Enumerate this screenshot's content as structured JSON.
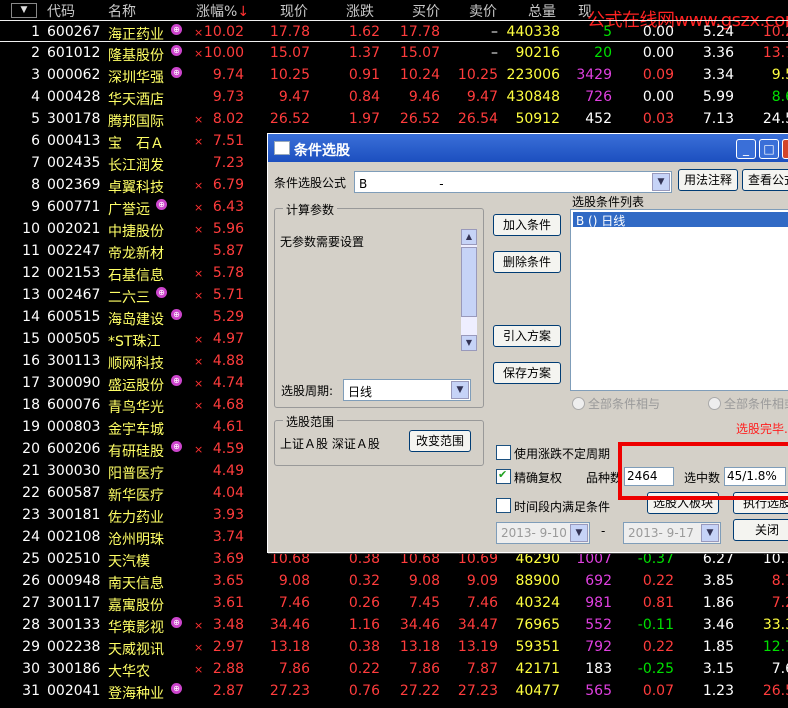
{
  "header": {
    "sort_btn": "▼",
    "cols": [
      "代码",
      "名称",
      "涨幅%",
      "现价",
      "涨跌",
      "买价",
      "卖价",
      "总量",
      "现"
    ],
    "sort_arrow": "↓"
  },
  "watermark": "公式在线网www.gszx.com.cn",
  "rows": [
    {
      "n": "1",
      "code": "600267",
      "name": "海正药业",
      "b": true,
      "x": "×",
      "chg": "10.02",
      "price": "17.78",
      "d": "1.62",
      "buy": "17.78",
      "sell": "–",
      "vol": "440338",
      "cur": "5",
      "su": "0.00",
      "tr": "5.24",
      "pe": "10.2"
    },
    {
      "n": "2",
      "code": "601012",
      "name": "隆基股份",
      "b": true,
      "x": "×",
      "chg": "10.00",
      "price": "15.07",
      "d": "1.37",
      "buy": "15.07",
      "sell": "–",
      "vol": "90216",
      "cur": "20",
      "su": "0.00",
      "tr": "3.36",
      "pe": "13.7"
    },
    {
      "n": "3",
      "code": "000062",
      "name": "深圳华强",
      "b": true,
      "x": "",
      "chg": "9.74",
      "price": "10.25",
      "d": "0.91",
      "buy": "10.24",
      "sell": "10.25",
      "vol": "223006",
      "cur": "3429",
      "su": "0.09",
      "tr": "3.34",
      "pe": "9.5"
    },
    {
      "n": "4",
      "code": "000428",
      "name": "华天酒店",
      "b": false,
      "x": "",
      "chg": "9.73",
      "price": "9.47",
      "d": "0.84",
      "buy": "9.46",
      "sell": "9.47",
      "vol": "430848",
      "cur": "726",
      "su": "0.00",
      "tr": "5.99",
      "pe": "8.6"
    },
    {
      "n": "5",
      "code": "300178",
      "name": "腾邦国际",
      "b": false,
      "x": "×",
      "chg": "8.02",
      "price": "26.52",
      "d": "1.97",
      "buy": "26.52",
      "sell": "26.54",
      "vol": "50912",
      "cur": "452",
      "su": "0.03",
      "tr": "7.13",
      "pe": "24.5"
    },
    {
      "n": "6",
      "code": "000413",
      "name": "宝　石Ａ",
      "b": false,
      "x": "×",
      "chg": "7.51",
      "price": "",
      "d": "",
      "buy": "",
      "sell": "",
      "vol": "",
      "cur": "",
      "su": "",
      "tr": "",
      "pe": ""
    },
    {
      "n": "7",
      "code": "002435",
      "name": "长江润发",
      "b": false,
      "x": "",
      "chg": "7.23",
      "price": "",
      "d": "",
      "buy": "",
      "sell": "",
      "vol": "",
      "cur": "",
      "su": "",
      "tr": "",
      "pe": ""
    },
    {
      "n": "8",
      "code": "002369",
      "name": "卓翼科技",
      "b": false,
      "x": "×",
      "chg": "6.79",
      "price": "",
      "d": "",
      "buy": "",
      "sell": "",
      "vol": "",
      "cur": "",
      "su": "",
      "tr": "",
      "pe": ""
    },
    {
      "n": "9",
      "code": "600771",
      "name": "广誉远",
      "b": true,
      "x": "×",
      "chg": "6.43",
      "price": "",
      "d": "",
      "buy": "",
      "sell": "",
      "vol": "",
      "cur": "",
      "su": "",
      "tr": "",
      "pe": ""
    },
    {
      "n": "10",
      "code": "002021",
      "name": "中捷股份",
      "b": false,
      "x": "×",
      "chg": "5.96",
      "price": "",
      "d": "",
      "buy": "",
      "sell": "",
      "vol": "",
      "cur": "",
      "su": "",
      "tr": "",
      "pe": ""
    },
    {
      "n": "11",
      "code": "002247",
      "name": "帝龙新材",
      "b": false,
      "x": "",
      "chg": "5.87",
      "price": "",
      "d": "",
      "buy": "",
      "sell": "",
      "vol": "",
      "cur": "",
      "su": "",
      "tr": "",
      "pe": ""
    },
    {
      "n": "12",
      "code": "002153",
      "name": "石基信息",
      "b": false,
      "x": "×",
      "chg": "5.78",
      "price": "",
      "d": "",
      "buy": "",
      "sell": "",
      "vol": "",
      "cur": "",
      "su": "",
      "tr": "",
      "pe": ""
    },
    {
      "n": "13",
      "code": "002467",
      "name": "二六三",
      "b": true,
      "x": "×",
      "chg": "5.71",
      "price": "",
      "d": "",
      "buy": "",
      "sell": "",
      "vol": "",
      "cur": "",
      "su": "",
      "tr": "",
      "pe": ""
    },
    {
      "n": "14",
      "code": "600515",
      "name": "海岛建设",
      "b": true,
      "x": "",
      "chg": "5.29",
      "price": "",
      "d": "",
      "buy": "",
      "sell": "",
      "vol": "",
      "cur": "",
      "su": "",
      "tr": "",
      "pe": ""
    },
    {
      "n": "15",
      "code": "000505",
      "name": "*ST珠江",
      "b": false,
      "x": "×",
      "chg": "4.97",
      "price": "",
      "d": "",
      "buy": "",
      "sell": "",
      "vol": "",
      "cur": "",
      "su": "",
      "tr": "",
      "pe": ""
    },
    {
      "n": "16",
      "code": "300113",
      "name": "顺网科技",
      "b": false,
      "x": "×",
      "chg": "4.88",
      "price": "",
      "d": "",
      "buy": "",
      "sell": "",
      "vol": "",
      "cur": "",
      "su": "",
      "tr": "",
      "pe": ""
    },
    {
      "n": "17",
      "code": "300090",
      "name": "盛运股份",
      "b": true,
      "x": "×",
      "chg": "4.74",
      "price": "",
      "d": "",
      "buy": "",
      "sell": "",
      "vol": "",
      "cur": "",
      "su": "",
      "tr": "",
      "pe": ""
    },
    {
      "n": "18",
      "code": "600076",
      "name": "青鸟华光",
      "b": false,
      "x": "×",
      "chg": "4.68",
      "price": "",
      "d": "",
      "buy": "",
      "sell": "",
      "vol": "",
      "cur": "",
      "su": "",
      "tr": "",
      "pe": ""
    },
    {
      "n": "19",
      "code": "000803",
      "name": "金宇车城",
      "b": false,
      "x": "",
      "chg": "4.61",
      "price": "",
      "d": "",
      "buy": "",
      "sell": "",
      "vol": "",
      "cur": "",
      "su": "",
      "tr": "",
      "pe": ""
    },
    {
      "n": "20",
      "code": "600206",
      "name": "有研硅股",
      "b": true,
      "x": "×",
      "chg": "4.59",
      "price": "",
      "d": "",
      "buy": "",
      "sell": "",
      "vol": "",
      "cur": "",
      "su": "",
      "tr": "",
      "pe": ""
    },
    {
      "n": "21",
      "code": "300030",
      "name": "阳普医疗",
      "b": false,
      "x": "",
      "chg": "4.49",
      "price": "",
      "d": "",
      "buy": "",
      "sell": "",
      "vol": "",
      "cur": "",
      "su": "",
      "tr": "",
      "pe": ""
    },
    {
      "n": "22",
      "code": "600587",
      "name": "新华医疗",
      "b": false,
      "x": "",
      "chg": "4.04",
      "price": "",
      "d": "",
      "buy": "",
      "sell": "",
      "vol": "",
      "cur": "",
      "su": "",
      "tr": "",
      "pe": ""
    },
    {
      "n": "23",
      "code": "300181",
      "name": "佐力药业",
      "b": false,
      "x": "",
      "chg": "3.93",
      "price": "",
      "d": "",
      "buy": "",
      "sell": "",
      "vol": "",
      "cur": "",
      "su": "",
      "tr": "",
      "pe": ""
    },
    {
      "n": "24",
      "code": "002108",
      "name": "沧州明珠",
      "b": false,
      "x": "",
      "chg": "3.74",
      "price": "",
      "d": "",
      "buy": "",
      "sell": "",
      "vol": "",
      "cur": "",
      "su": "",
      "tr": "",
      "pe": ""
    },
    {
      "n": "25",
      "code": "002510",
      "name": "天汽模",
      "b": false,
      "x": "",
      "chg": "3.69",
      "price": "10.68",
      "d": "0.38",
      "buy": "10.68",
      "sell": "10.69",
      "vol": "46290",
      "cur": "1007",
      "su": "-0.37",
      "tr": "6.27",
      "pe": "10.7"
    },
    {
      "n": "26",
      "code": "000948",
      "name": "南天信息",
      "b": false,
      "x": "",
      "chg": "3.65",
      "price": "9.08",
      "d": "0.32",
      "buy": "9.08",
      "sell": "9.09",
      "vol": "88900",
      "cur": "692",
      "su": "0.22",
      "tr": "3.85",
      "pe": "8.7"
    },
    {
      "n": "27",
      "code": "300117",
      "name": "嘉寓股份",
      "b": false,
      "x": "",
      "chg": "3.61",
      "price": "7.46",
      "d": "0.26",
      "buy": "7.45",
      "sell": "7.46",
      "vol": "40324",
      "cur": "981",
      "su": "0.81",
      "tr": "1.86",
      "pe": "7.2"
    },
    {
      "n": "28",
      "code": "300133",
      "name": "华策影视",
      "b": true,
      "x": "×",
      "chg": "3.48",
      "price": "34.46",
      "d": "1.16",
      "buy": "34.46",
      "sell": "34.47",
      "vol": "76965",
      "cur": "552",
      "su": "-0.11",
      "tr": "3.46",
      "pe": "33.3"
    },
    {
      "n": "29",
      "code": "002238",
      "name": "天威视讯",
      "b": false,
      "x": "×",
      "chg": "2.97",
      "price": "13.18",
      "d": "0.38",
      "buy": "13.18",
      "sell": "13.19",
      "vol": "59351",
      "cur": "792",
      "su": "0.22",
      "tr": "1.85",
      "pe": "12.7"
    },
    {
      "n": "30",
      "code": "300186",
      "name": "大华农",
      "b": false,
      "x": "×",
      "chg": "2.88",
      "price": "7.86",
      "d": "0.22",
      "buy": "7.86",
      "sell": "7.87",
      "vol": "42171",
      "cur": "183",
      "su": "-0.25",
      "tr": "3.15",
      "pe": "7.6"
    },
    {
      "n": "31",
      "code": "002041",
      "name": "登海种业",
      "b": true,
      "x": "",
      "chg": "2.87",
      "price": "27.23",
      "d": "0.76",
      "buy": "27.22",
      "sell": "27.23",
      "vol": "40477",
      "cur": "565",
      "su": "0.07",
      "tr": "1.23",
      "pe": "26.5"
    }
  ],
  "dialog": {
    "title": "条件选股",
    "formula_label": "条件选股公式",
    "formula_value": "B　　　　　　-",
    "usage_btn": "用法注释",
    "view_btn": "查看公式",
    "params_group": "计算参数",
    "params_text": "无参数需要设置",
    "add_btn": "加入条件",
    "del_btn": "删除条件",
    "import_btn": "引入方案",
    "save_btn": "保存方案",
    "list_title": "选股条件列表",
    "list_item": "B () 日线",
    "period_label": "选股周期:",
    "period_value": "日线",
    "radio_and": "全部条件相与",
    "radio_or": "全部条件相或",
    "finish_text": "选股完毕.",
    "range_group": "选股范围",
    "range_text": "上证Ａ股 深证Ａ股",
    "range_btn": "改变范围",
    "chk1": "使用涨跌不定周期",
    "chk2": "精确复权",
    "chk3": "时间段内满足条件",
    "count_label": "品种数",
    "count_value": "2464",
    "sel_label": "选中数",
    "sel_value": "45/1.8%",
    "to_block_btn": "选股入板块",
    "run_btn": "执行选股",
    "close_btn": "关闭",
    "date_from": "2013- 9-10",
    "date_sep": "-",
    "date_to": "2013- 9-17"
  }
}
